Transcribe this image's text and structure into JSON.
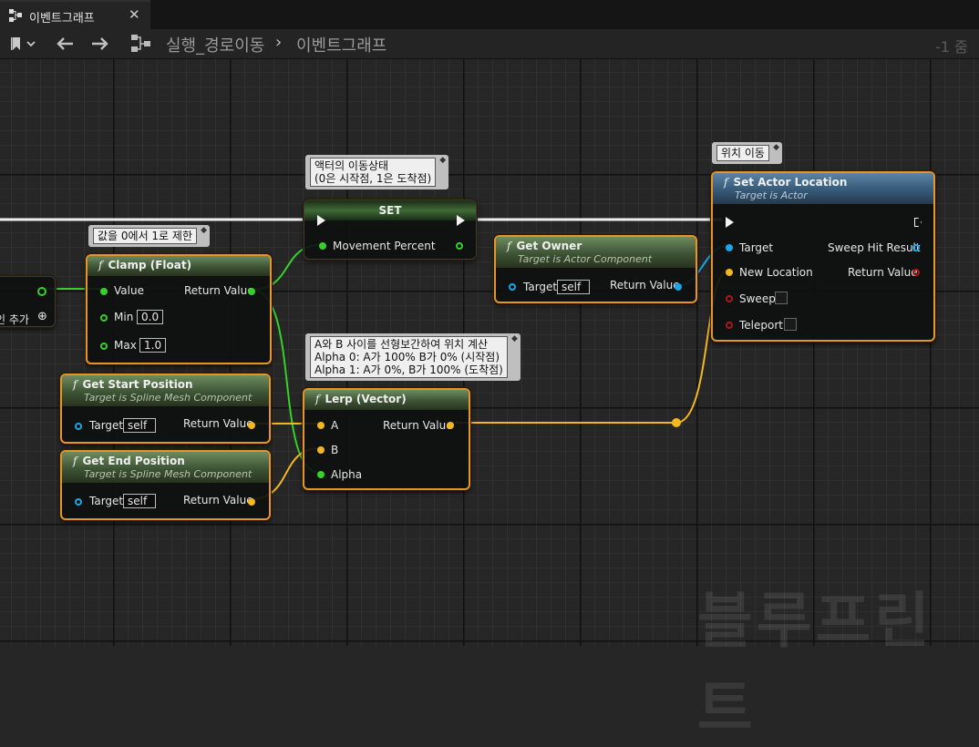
{
  "tab": {
    "title": "이벤트그래프",
    "close": "✕"
  },
  "toolbar": {
    "breadcrumb": [
      "실행_경로이동",
      "이벤트그래프"
    ],
    "separator": "›",
    "zoom": "-1 줌"
  },
  "left_node": {
    "label": "인 추가"
  },
  "comments": {
    "set": "액터의 이동상태\n(0은 시작점, 1은 도착점)",
    "clamp": "값을 0에서 1로 제한",
    "lerp": "A와 B 사이를 선형보간하여 위치 계산\nAlpha 0: A가 100% B가 0% (시작점)\nAlpha 1: A가 0%, B가 100% (도착점)",
    "setloc": "위치 이동"
  },
  "nodes": {
    "set": {
      "title": "SET",
      "pin": "Movement Percent"
    },
    "clamp": {
      "title": "Clamp (Float)",
      "value": "Value",
      "min_label": "Min",
      "min": "0.0",
      "max_label": "Max",
      "max": "1.0",
      "ret": "Return Value"
    },
    "get_start": {
      "title": "Get Start Position",
      "subtitle": "Target is Spline Mesh Component",
      "target": "Target",
      "self": "self",
      "ret": "Return Value"
    },
    "get_end": {
      "title": "Get End Position",
      "subtitle": "Target is Spline Mesh Component",
      "target": "Target",
      "self": "self",
      "ret": "Return Value"
    },
    "lerp": {
      "title": "Lerp (Vector)",
      "a": "A",
      "b": "B",
      "alpha": "Alpha",
      "ret": "Return Value"
    },
    "get_owner": {
      "title": "Get Owner",
      "subtitle": "Target is Actor Component",
      "target": "Target",
      "self": "self",
      "ret": "Return Value"
    },
    "setloc": {
      "title": "Set Actor Location",
      "subtitle": "Target is Actor",
      "target": "Target",
      "new_loc": "New Location",
      "sweep": "Sweep",
      "teleport": "Teleport",
      "hit": "Sweep Hit Result",
      "ret": "Return Value"
    }
  },
  "watermark": "블루프린트",
  "colors": {
    "exec": "#f2f2f2",
    "float": "#35d12a",
    "vector": "#f3b71f",
    "object": "#19a7e8",
    "struct": "#b01818",
    "selected": "#e5952a"
  }
}
